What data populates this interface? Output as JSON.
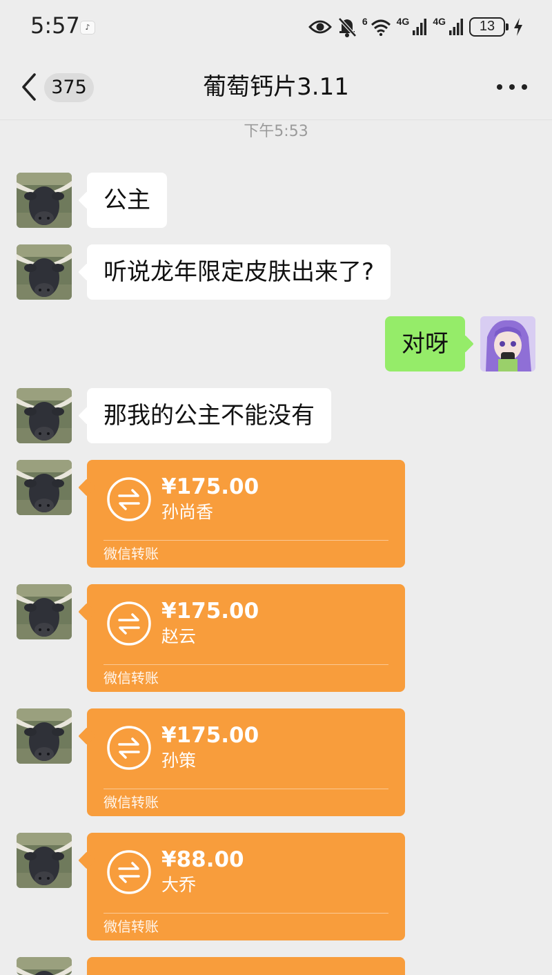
{
  "status_bar": {
    "time": "5:57",
    "app_badge": "♪",
    "signal_1_label": "4G",
    "signal_2_label": "4G",
    "wifi_label": "6",
    "battery": "13"
  },
  "nav": {
    "unread_count": "375",
    "title": "葡萄钙片3.11"
  },
  "timestamp": "下午5:53",
  "messages": [
    {
      "text": "公主"
    },
    {
      "text": "听说龙年限定皮肤出来了?"
    },
    {
      "text": "对呀"
    },
    {
      "text": "那我的公主不能没有"
    }
  ],
  "transfers": [
    {
      "amount": "¥175.00",
      "note": "孙尚香",
      "label": "微信转账"
    },
    {
      "amount": "¥175.00",
      "note": "赵云",
      "label": "微信转账"
    },
    {
      "amount": "¥175.00",
      "note": "孙策",
      "label": "微信转账"
    },
    {
      "amount": "¥88.00",
      "note": "大乔",
      "label": "微信转账"
    }
  ],
  "colors": {
    "background": "#ededed",
    "incoming_bubble": "#ffffff",
    "outgoing_bubble": "#95ec69",
    "transfer_card": "#f89d3c"
  },
  "icons": {
    "back": "chevron-left-icon",
    "more": "more-dots-icon",
    "transfer": "transfer-arrows-icon",
    "visibility": "eye-icon",
    "mute": "bell-off-icon",
    "wifi": "wifi-icon",
    "charging": "lightning-icon"
  }
}
